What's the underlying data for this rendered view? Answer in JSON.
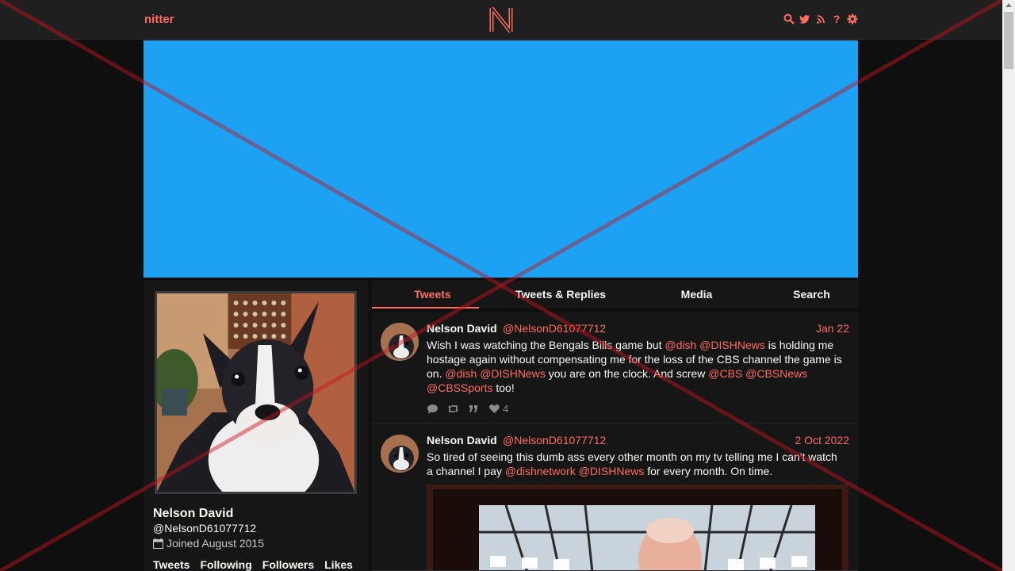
{
  "nav": {
    "brand": "nitter",
    "icons": [
      "search-icon",
      "twitter-icon",
      "rss-icon",
      "help-icon",
      "gear-icon"
    ],
    "help_label": "?"
  },
  "colors": {
    "accent": "#ff6c60",
    "banner": "#1da1f2",
    "background": "#0f0f0f",
    "panel": "#161616"
  },
  "profile": {
    "name": "Nelson David",
    "handle": "@NelsonD61077712",
    "joined": "Joined August 2015",
    "stats": [
      "Tweets",
      "Following",
      "Followers",
      "Likes"
    ]
  },
  "tabs": [
    {
      "label": "Tweets",
      "active": true
    },
    {
      "label": "Tweets & Replies",
      "active": false
    },
    {
      "label": "Media",
      "active": false
    },
    {
      "label": "Search",
      "active": false
    }
  ],
  "tweets": [
    {
      "name": "Nelson David",
      "handle": "@NelsonD61077712",
      "date": "Jan 22",
      "segments": [
        {
          "t": "Wish I was watching the Bengals Bills game but ",
          "m": false
        },
        {
          "t": "@dish",
          "m": true
        },
        {
          "t": " ",
          "m": false
        },
        {
          "t": "@DISHNews",
          "m": true
        },
        {
          "t": " is holding me hostage again without compensating me for the loss of the CBS channel the game is on. ",
          "m": false
        },
        {
          "t": "@dish",
          "m": true
        },
        {
          "t": " ",
          "m": false
        },
        {
          "t": "@DISHNews",
          "m": true
        },
        {
          "t": " you are on the clock. And screw ",
          "m": false
        },
        {
          "t": "@CBS",
          "m": true
        },
        {
          "t": " ",
          "m": false
        },
        {
          "t": "@CBSNews",
          "m": true
        },
        {
          "t": " ",
          "m": false
        },
        {
          "t": "@CBSSports",
          "m": true
        },
        {
          "t": " too!",
          "m": false
        }
      ],
      "likes": "4"
    },
    {
      "name": "Nelson David",
      "handle": "@NelsonD61077712",
      "date": "2 Oct 2022",
      "segments": [
        {
          "t": "So tired of seeing this dumb ass every other month on my tv telling me I can't watch a channel I pay ",
          "m": false
        },
        {
          "t": "@dishnetwork",
          "m": true
        },
        {
          "t": " ",
          "m": false
        },
        {
          "t": "@DISHNews",
          "m": true
        },
        {
          "t": " for every month. On time.",
          "m": false
        }
      ]
    }
  ]
}
